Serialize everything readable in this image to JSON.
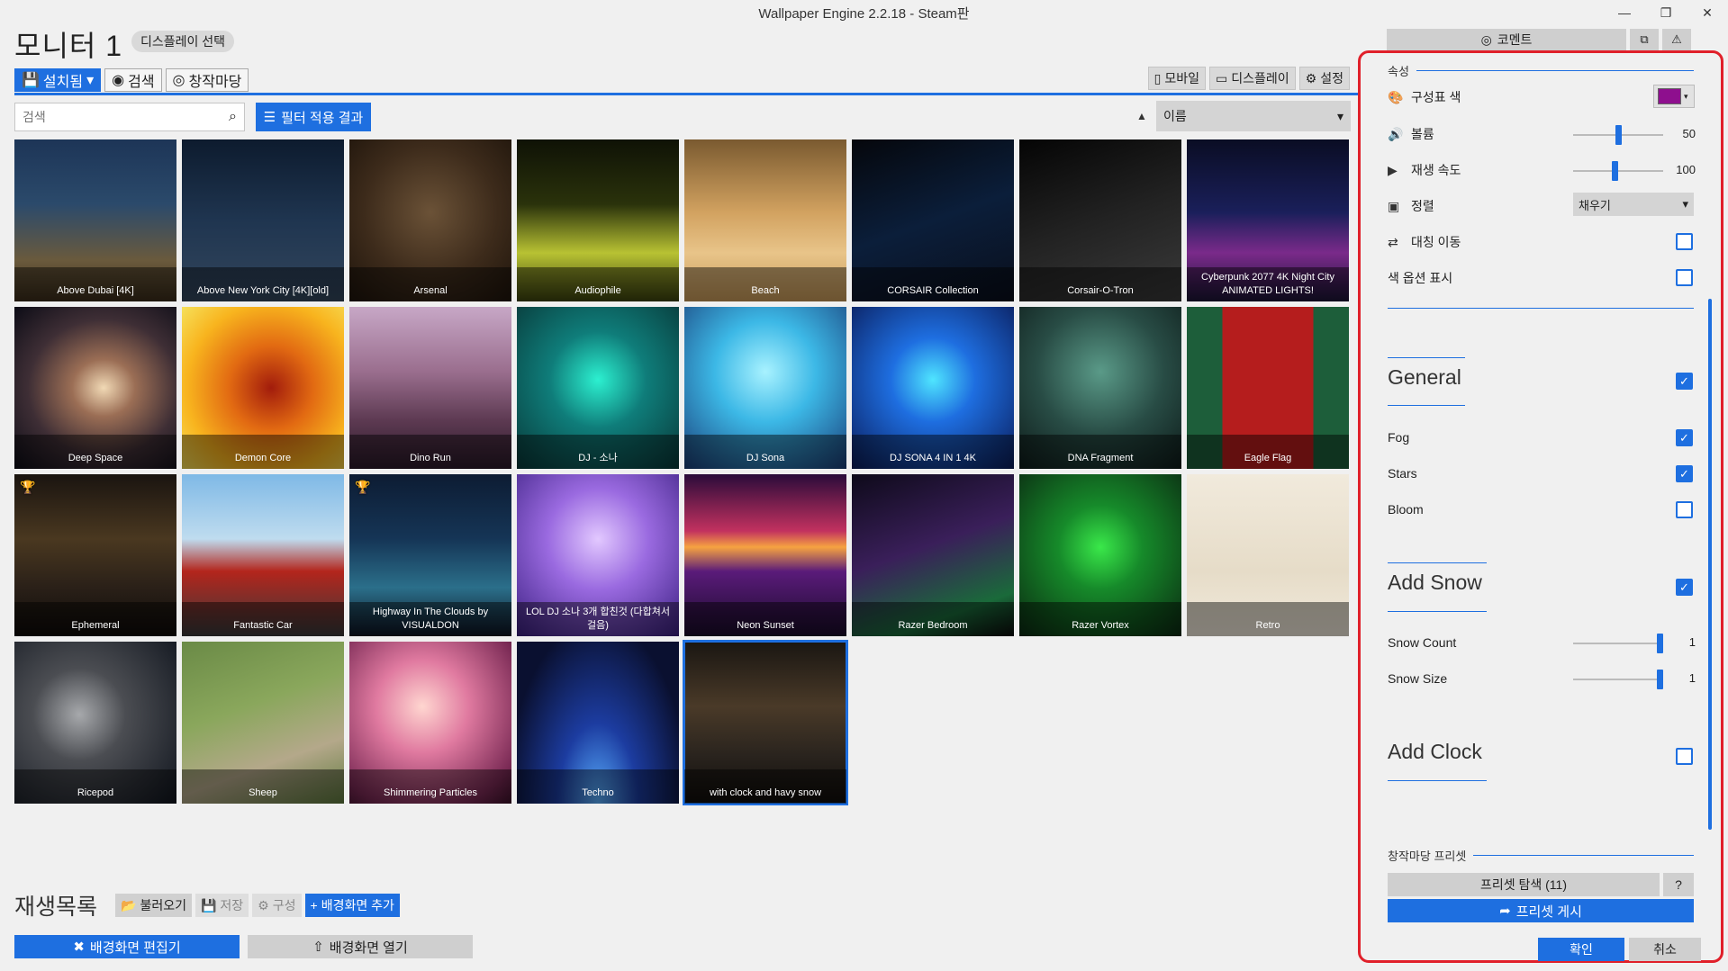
{
  "window": {
    "title": "Wallpaper Engine 2.2.18 - Steam판",
    "minimize": "—",
    "restore": "❐",
    "close": "✕"
  },
  "header": {
    "monitor_title": "모니터 1",
    "display_select": "디스플레이 선택"
  },
  "tabs": [
    {
      "label": "설치됨",
      "icon": "save-icon",
      "glyph": "💾",
      "caret": "▾"
    },
    {
      "label": "검색",
      "icon": "compass-icon",
      "glyph": "◉"
    },
    {
      "label": "창작마당",
      "icon": "steam-icon",
      "glyph": "◎"
    }
  ],
  "right_tabs": [
    {
      "label": "모바일",
      "icon": "mobile-icon",
      "glyph": "▯"
    },
    {
      "label": "디스플레이",
      "icon": "monitor-icon",
      "glyph": "▭"
    },
    {
      "label": "설정",
      "icon": "gear-icon",
      "glyph": "⚙"
    }
  ],
  "search": {
    "placeholder": "검색",
    "icon": "search-icon",
    "glyph": "⌕"
  },
  "filter_button": {
    "label": "필터 적용 결과",
    "icon": "filter-list-icon",
    "glyph": "☰"
  },
  "sort": {
    "direction_glyph": "▲",
    "value": "이름",
    "caret": "▾"
  },
  "wallpapers": [
    {
      "title": "Above Dubai [4K]",
      "bg": "linear-gradient(180deg,#1d3557 0%,#2b4a6b 40%,#6a5a3c 75%,#3a2c1a 100%)"
    },
    {
      "title": "Above New York City [4K][old]",
      "bg": "linear-gradient(180deg,#0d1b2e 0%,#1f3550 50%,#33465c 100%)"
    },
    {
      "title": "Arsenal",
      "bg": "radial-gradient(circle at 50% 45%,#6b5237 0%,#3d2b1b 55%,#1e140b 100%)"
    },
    {
      "title": "Audiophile",
      "bg": "linear-gradient(180deg,#0f1206 0%,#2a320b 40%,#b8c233 70%,#3b420d 100%)"
    },
    {
      "title": "Beach",
      "bg": "linear-gradient(180deg,#7a5a30 0%,#d2a260 45%,#e8c489 70%,#c79958 100%)"
    },
    {
      "title": "CORSAIR Collection",
      "bg": "linear-gradient(160deg,#05070c 0%,#0b1e3a 50%,#0a0f1c 100%)"
    },
    {
      "title": "Corsair-O-Tron",
      "bg": "linear-gradient(160deg,#050505 0%,#222 50%,#3a3a3a 100%)"
    },
    {
      "title": "Cyberpunk 2077 4K Night City ANIMATED LIGHTS!",
      "bg": "linear-gradient(180deg,#0a0d24 0%,#1a1f5a 45%,#7a2a8a 70%,#1b1436 100%)"
    },
    {
      "title": "Deep Space",
      "bg": "radial-gradient(ellipse at 55% 50%,#f1d9b5 0%,#9b6e55 25%,#3e2e35 60%,#0c0c16 100%)"
    },
    {
      "title": "Demon Core",
      "bg": "radial-gradient(circle at 55% 50%,#a21c0c 0%,#e26a12 35%,#f8b41e 70%,#f6e05a 100%)"
    },
    {
      "title": "Dino Run",
      "bg": "linear-gradient(180deg,#c7a7c6 0%,#9a6e8e 40%,#5d3a52 70%,#2c1a2a 100%)"
    },
    {
      "title": "DJ - 소나",
      "bg": "radial-gradient(circle at 50% 45%,#2cf0d0 0%,#0f7d7a 40%,#083838 100%)"
    },
    {
      "title": "DJ Sona",
      "bg": "radial-gradient(circle at 50% 40%,#a8f2ff 0%,#3cb8e6 40%,#1a3d78 100%)"
    },
    {
      "title": "DJ SONA 4 IN 1 4K",
      "bg": "radial-gradient(circle at 50% 45%,#4fe5ff 0%,#1e6ee0 35%,#0a1c5a 100%)"
    },
    {
      "title": "DNA Fragment",
      "bg": "radial-gradient(circle at 50% 40%,#5a9a88 0%,#284c45 50%,#0e1c1a 100%)"
    },
    {
      "title": "Eagle Flag",
      "bg": "linear-gradient(90deg,#1d5e3a 0%,#1d5e3a 22%,#b51d1d 22%,#b51d1d 78%,#1d5e3a 78%)"
    },
    {
      "title": "Ephemeral",
      "bg": "linear-gradient(180deg,#1a1410 0%,#4a3820 40%,#2a2018 70%,#0e0b08 100%)",
      "trophy": true
    },
    {
      "title": "Fantastic Car",
      "bg": "linear-gradient(180deg,#7fb9e6 0%,#bfdcef 40%,#b3251c 60%,#3a3a3a 100%)"
    },
    {
      "title": "Highway In The Clouds by VISUALDON",
      "bg": "linear-gradient(180deg,#0d1c33 0%,#153556 40%,#2b6f8a 70%,#0d1423 100%)",
      "trophy": true
    },
    {
      "title": "LOL DJ 소나 3개 합친것 (다합쳐서 걸음)",
      "bg": "radial-gradient(circle at 50% 40%,#e2c8ff 0%,#9a6ae0 40%,#3a1f80 100%)"
    },
    {
      "title": "Neon Sunset",
      "bg": "linear-gradient(180deg,#2a0b3a 0%,#c2315f 35%,#f6a341 45%,#5a1b7a 60%,#1a0b2a 100%)"
    },
    {
      "title": "Razer Bedroom",
      "bg": "linear-gradient(160deg,#0e0a1a 0%,#3a1f5a 45%,#1a6a3a 80%,#0b0b0b 100%)"
    },
    {
      "title": "Razer Vortex",
      "bg": "radial-gradient(circle at 50% 45%,#3ae84a 0%,#168a2a 35%,#0b2a12 100%)"
    },
    {
      "title": "Retro",
      "bg": "linear-gradient(180deg,#f1eadc 0%,#e6dcc8 60%,#f1eadc 100%)"
    },
    {
      "title": "Ricepod",
      "bg": "radial-gradient(circle at 40% 45%,#a7a9ac 0%,#4b4d52 35%,#10151e 100%)"
    },
    {
      "title": "Sheep",
      "bg": "linear-gradient(160deg,#6a8a46 0%,#8aa75c 40%,#b4a88a 70%,#5f7a3e 100%)"
    },
    {
      "title": "Shimmering Particles",
      "bg": "radial-gradient(circle at 45% 40%,#ffd6d0 0%,#e07aa0 35%,#7a2a55 80%,#3a1028 100%)"
    },
    {
      "title": "Techno",
      "bg": "radial-gradient(ellipse at 50% 100%,#5ab0ff 0%,#1c3ca0 35%,#0a1030 80%)"
    },
    {
      "title": "with clock and havy snow",
      "bg": "linear-gradient(180deg,#1a1612 0%,#4a3a28 40%,#2a241e 70%,#100d0a 100%)",
      "selected": true
    }
  ],
  "playlist": {
    "title": "재생목록",
    "buttons": [
      {
        "label": "불러오기",
        "icon": "folder-open-icon",
        "glyph": "📂",
        "style": ""
      },
      {
        "label": "저장",
        "icon": "save-icon",
        "glyph": "💾",
        "style": "dim"
      },
      {
        "label": "구성",
        "icon": "gears-icon",
        "glyph": "⚙",
        "style": "dim"
      },
      {
        "label": "배경화면 추가",
        "icon": "plus-icon",
        "glyph": "+",
        "style": "blue"
      }
    ],
    "edit_button": {
      "label": "배경화면 편집기",
      "icon": "tools-icon",
      "glyph": "✖"
    },
    "open_button": {
      "label": "배경화면 열기",
      "icon": "upload-icon",
      "glyph": "⇧"
    }
  },
  "right_panel": {
    "comment_button": {
      "label": "코멘트",
      "icon": "steam-icon",
      "glyph": "◎"
    },
    "copy_icon_glyph": "⧉",
    "warn_icon_glyph": "⚠",
    "section_properties": "속성",
    "scheme_color": {
      "label": "구성표 색",
      "icon": "palette-icon",
      "glyph": "🎨",
      "color": "#8e0f8e",
      "caret": "▾"
    },
    "volume": {
      "label": "볼륨",
      "icon": "volume-icon",
      "glyph": "🔊",
      "value": "50",
      "fraction": 0.5
    },
    "playback_speed": {
      "label": "재생 속도",
      "icon": "play-icon",
      "glyph": "▶",
      "value": "100",
      "fraction": 0.46
    },
    "alignment": {
      "label": "정렬",
      "icon": "image-icon",
      "glyph": "▣",
      "value": "채우기",
      "caret": "▾"
    },
    "mirror": {
      "label": "대칭 이동",
      "icon": "swap-icon",
      "glyph": "⇄",
      "checked": false
    },
    "show_color_options": {
      "label": "색 옵션 표시",
      "checked": false
    },
    "general": {
      "label": "General",
      "checked": true
    },
    "fog": {
      "label": "Fog",
      "checked": true
    },
    "stars": {
      "label": "Stars",
      "checked": true
    },
    "bloom": {
      "label": "Bloom",
      "checked": false
    },
    "add_snow": {
      "label": "Add Snow",
      "checked": true
    },
    "snow_count": {
      "label": "Snow Count",
      "value": "1",
      "fraction": 1.0
    },
    "snow_size": {
      "label": "Snow Size",
      "value": "1",
      "fraction": 1.0
    },
    "add_clock": {
      "label": "Add Clock",
      "checked": false
    },
    "section_presets": "창작마당 프리셋",
    "preset_browse": "프리셋 탐색 (11)",
    "preset_help": "?",
    "preset_publish": {
      "label": "프리셋 게시",
      "icon": "share-icon",
      "glyph": "➦"
    },
    "ok": "확인",
    "cancel": "취소"
  },
  "colors": {
    "accent": "#1e6fe0",
    "highlight_border": "#e0202a"
  }
}
